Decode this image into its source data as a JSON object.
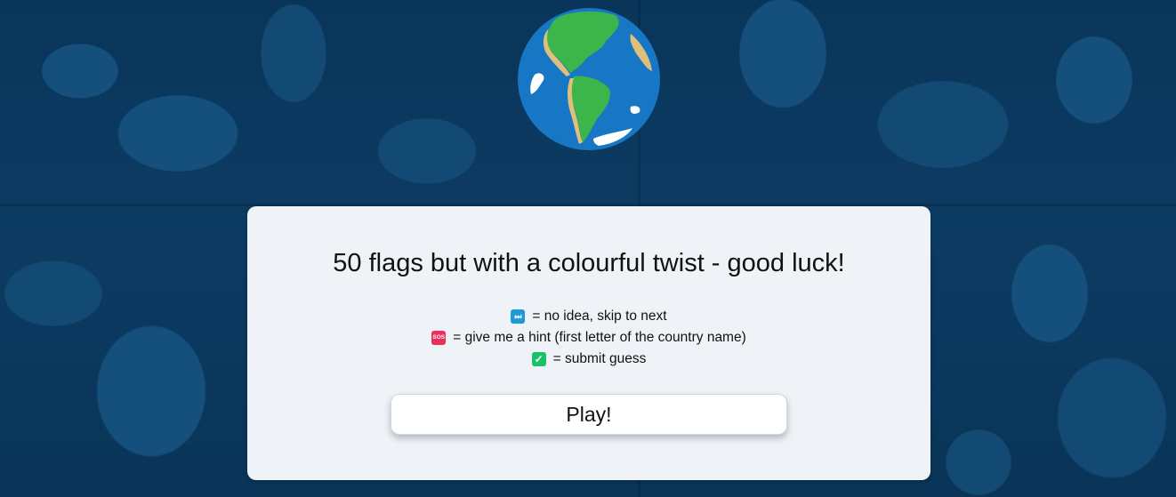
{
  "title": "50 flags but with a colourful twist - good luck!",
  "legend": [
    {
      "icon": "fast-forward-icon",
      "text": "= no idea, skip to next"
    },
    {
      "icon": "sos-icon",
      "text": "= give me a hint (first letter of the country name)"
    },
    {
      "icon": "check-mark-icon",
      "text": "= submit guess"
    }
  ],
  "icons": {
    "skip_glyph": "⏭",
    "sos_glyph": "SOS",
    "check_glyph": "✓"
  },
  "play_button": {
    "label": "Play!"
  },
  "colors": {
    "background": "#0b3a5e",
    "card": "#eff3f8",
    "skip": "#1e9bd7",
    "sos": "#e8305a",
    "check": "#19c26a"
  }
}
